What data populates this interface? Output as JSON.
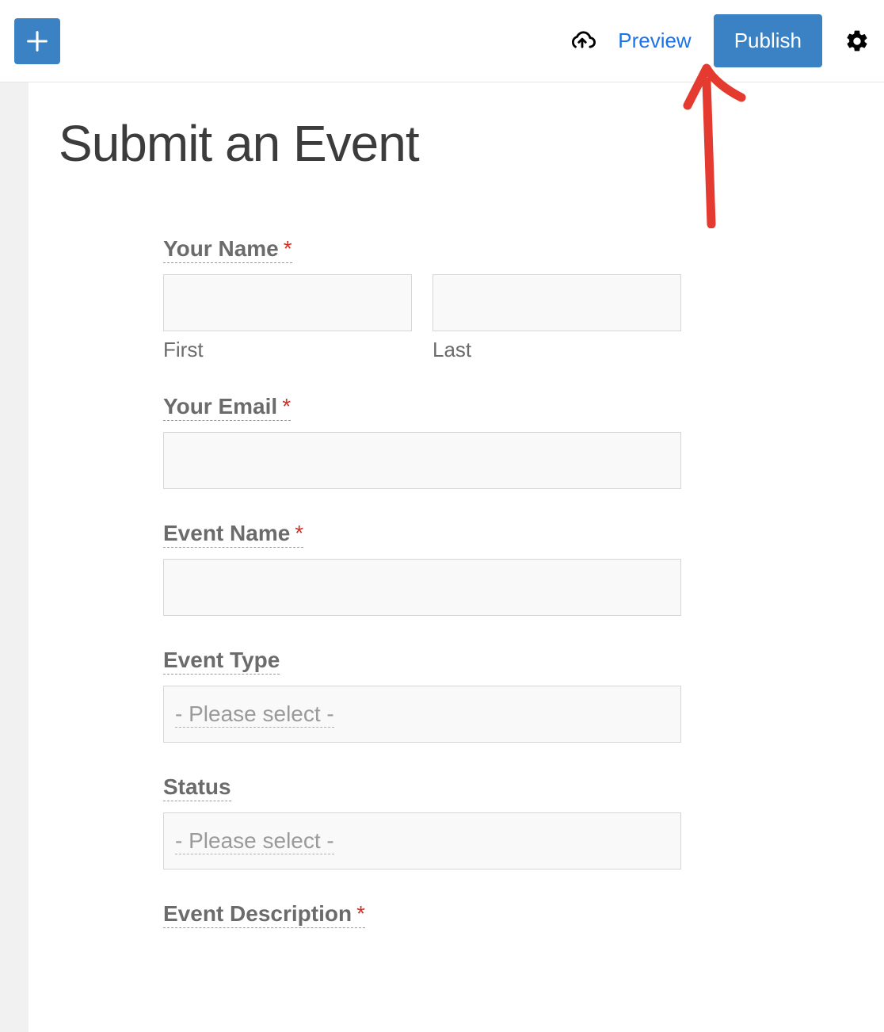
{
  "toolbar": {
    "preview_label": "Preview",
    "publish_label": "Publish"
  },
  "page": {
    "title": "Submit an Event"
  },
  "form": {
    "your_name": {
      "label": "Your Name",
      "required": "*",
      "first_sub": "First",
      "last_sub": "Last"
    },
    "your_email": {
      "label": "Your Email",
      "required": "*"
    },
    "event_name": {
      "label": "Event Name",
      "required": "*"
    },
    "event_type": {
      "label": "Event Type",
      "placeholder": "- Please select -"
    },
    "status": {
      "label": "Status",
      "placeholder": "- Please select -"
    },
    "event_description": {
      "label": "Event Description",
      "required": "*"
    }
  }
}
